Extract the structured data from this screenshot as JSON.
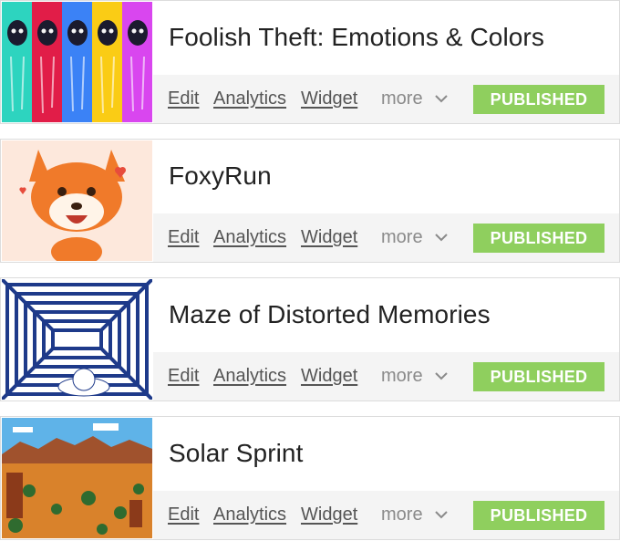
{
  "games": [
    {
      "title": "Foolish Theft: Emotions & Colors",
      "actions": {
        "edit": "Edit",
        "analytics": "Analytics",
        "widget": "Widget",
        "more": "more"
      },
      "status": "PUBLISHED",
      "thumbnail_icon": "hooded-figures-thumbnail"
    },
    {
      "title": "FoxyRun",
      "actions": {
        "edit": "Edit",
        "analytics": "Analytics",
        "widget": "Widget",
        "more": "more"
      },
      "status": "PUBLISHED",
      "thumbnail_icon": "fox-thumbnail"
    },
    {
      "title": "Maze of Distorted Memories",
      "actions": {
        "edit": "Edit",
        "analytics": "Analytics",
        "widget": "Widget",
        "more": "more"
      },
      "status": "PUBLISHED",
      "thumbnail_icon": "maze-thumbnail"
    },
    {
      "title": "Solar Sprint",
      "actions": {
        "edit": "Edit",
        "analytics": "Analytics",
        "widget": "Widget",
        "more": "more"
      },
      "status": "PUBLISHED",
      "thumbnail_icon": "desert-landscape-thumbnail"
    }
  ],
  "colors": {
    "published_badge": "#8fcf5e",
    "toolbar_bg": "#f4f4f4",
    "link": "#555555",
    "title": "#222222"
  }
}
